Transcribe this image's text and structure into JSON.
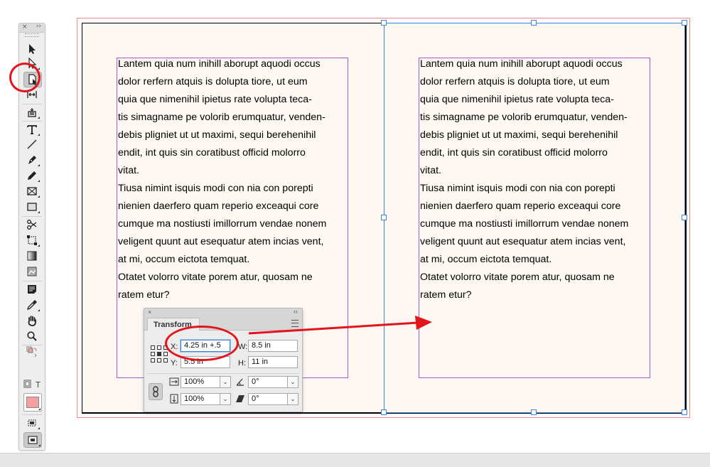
{
  "toolbox": {
    "close_glyph": "×",
    "collapse_glyph": "››",
    "tools": [
      {
        "name": "selection-tool",
        "icon": "arrow-icon"
      },
      {
        "name": "direct-selection-tool",
        "icon": "hollow-arrow-icon"
      },
      {
        "name": "page-tool",
        "icon": "page-tool-icon",
        "selected": true
      },
      {
        "name": "gap-tool",
        "icon": "gap-icon"
      },
      {
        "name": "content-collector-tool",
        "icon": "content-collector-icon"
      },
      {
        "name": "type-tool",
        "icon": "type-icon",
        "glyph": "T"
      },
      {
        "name": "line-tool",
        "icon": "line-icon"
      },
      {
        "name": "pen-tool",
        "icon": "pen-icon"
      },
      {
        "name": "pencil-tool",
        "icon": "pencil-icon"
      },
      {
        "name": "rectangle-frame-tool",
        "icon": "rectangle-frame-icon"
      },
      {
        "name": "rectangle-tool",
        "icon": "rectangle-icon"
      },
      {
        "name": "scissors-tool",
        "icon": "scissors-icon"
      },
      {
        "name": "free-transform-tool",
        "icon": "free-transform-icon"
      },
      {
        "name": "gradient-swatch-tool",
        "icon": "gradient-icon"
      },
      {
        "name": "gradient-feather-tool",
        "icon": "gradient-feather-icon"
      },
      {
        "name": "note-tool",
        "icon": "note-icon"
      },
      {
        "name": "eyedropper-tool",
        "icon": "eyedropper-icon"
      },
      {
        "name": "hand-tool",
        "icon": "hand-icon"
      },
      {
        "name": "zoom-tool",
        "icon": "zoom-icon"
      }
    ],
    "formatting_glyph": "T",
    "fill_color": "#f2a0a0",
    "accent_color": "#e3141b"
  },
  "document": {
    "left_page": {
      "lines": [
        "Lantem quia num inihill aborupt aquodi occus",
        "dolor rerfern atquis is dolupta tiore, ut eum",
        "quia que nimenihil ipietus rate volupta teca-",
        "tis simagname pe volorib erumquatur, venden-",
        "debis pligniet ut ut maximi, sequi berehenihil",
        "endit, int quis sin coratibust officid molorro",
        "vitat.",
        "Tiusa nimint isquis modi con nia con porepti",
        "nienien daerfero quam reperio exceaqui core",
        "cumque ma nostiusti imillorrum vendae nonem",
        "veligent quunt aut esequatur atem incias vent,",
        "at mi, occum eictota temquat.",
        "Otatet volorro vitate porem atur, quosam ne",
        "ratem etur?"
      ]
    },
    "right_page": {
      "lines": [
        "Lantem quia num inihill aborupt aquodi occus",
        "dolor rerfern atquis is dolupta tiore, ut eum",
        "quia que nimenihil ipietus rate volupta teca-",
        "tis simagname pe volorib erumquatur, venden-",
        "debis pligniet ut ut maximi, sequi berehenihil",
        "endit, int quis sin coratibust officid molorro",
        "vitat.",
        "Tiusa nimint isquis modi con nia con porepti",
        "nienien daerfero quam reperio exceaqui core",
        "cumque ma nostiusti imillorrum vendae nonem",
        "veligent quunt aut esequatur atem incias vent,",
        "at mi, occum eictota temquat.",
        "Otatet volorro vitate porem atur, quosam ne",
        "ratem etur?"
      ]
    },
    "frame_color": "#b452d8",
    "selection_color": "#3b86d8",
    "page_color": "#fdf8f2"
  },
  "transform_panel": {
    "close_glyph": "×",
    "collapse_glyph": "‹‹",
    "tab_label": "Transform",
    "x_label": "X:",
    "x_value": "4.25 in +.5",
    "y_label": "Y:",
    "y_value": "5.5 in",
    "w_label": "W:",
    "w_value": "8.5 in",
    "h_label": "H:",
    "h_value": "11 in",
    "scale_x_value": "100%",
    "scale_y_value": "100%",
    "rotation_value": "0°",
    "shear_value": "0°",
    "dropdown_glyph": "⌄"
  }
}
